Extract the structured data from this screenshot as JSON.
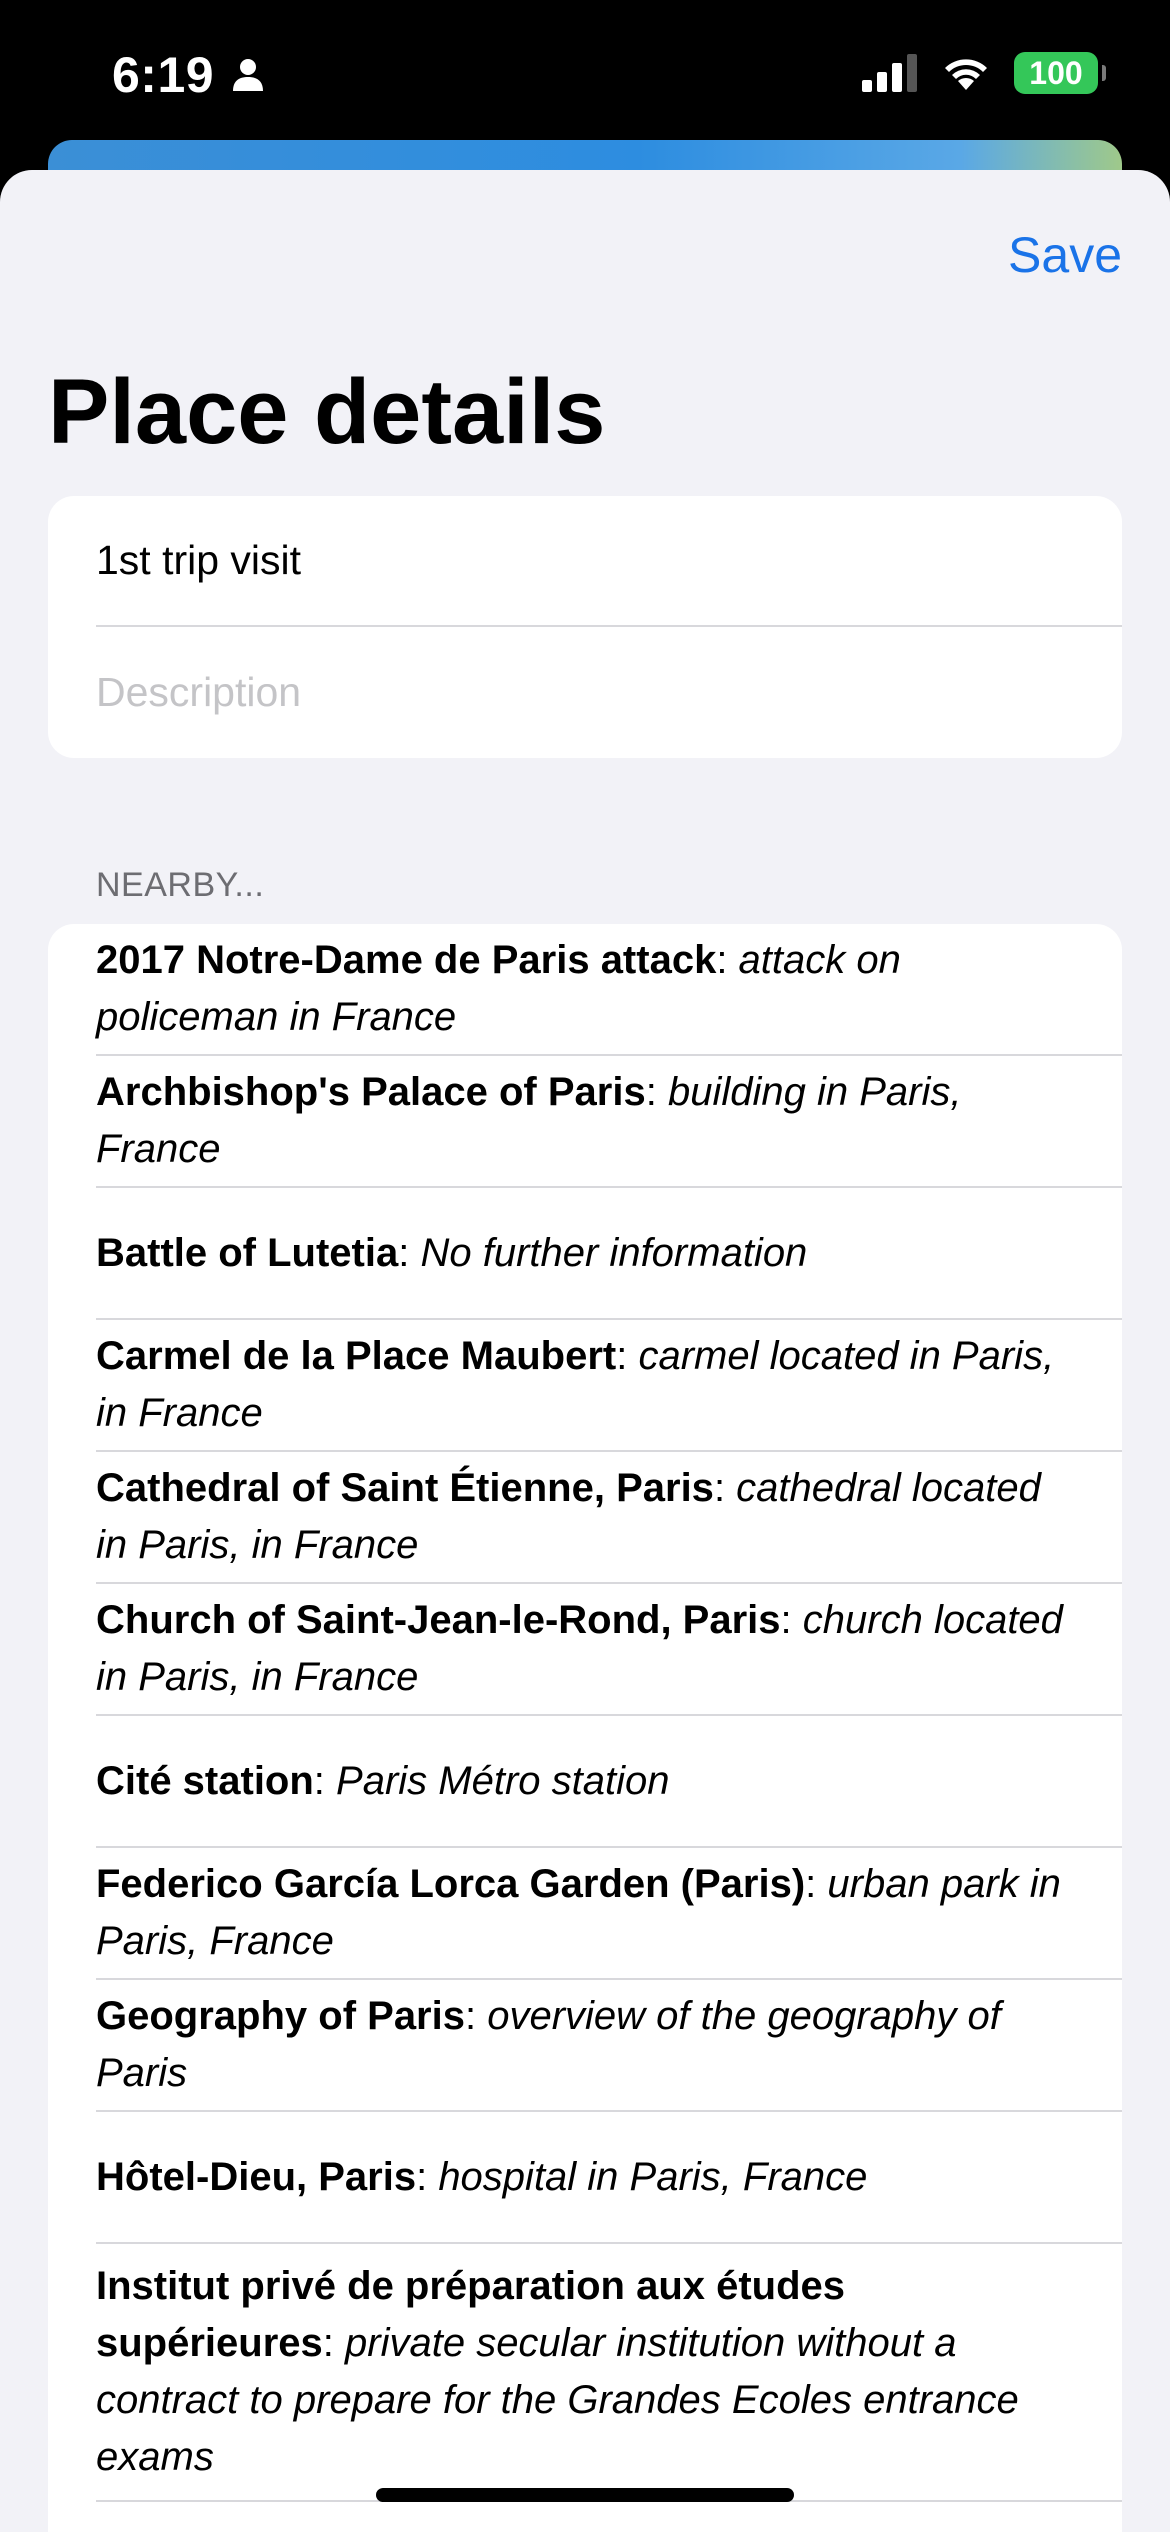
{
  "status_bar": {
    "time": "6:19",
    "battery": "100",
    "icons": [
      "person-icon",
      "signal-icon",
      "wifi-icon",
      "battery-icon"
    ]
  },
  "header": {
    "save_label": "Save",
    "title": "Place details"
  },
  "form": {
    "name_value": "1st trip visit",
    "description_placeholder": "Description"
  },
  "nearby": {
    "section_label": "NEARBY...",
    "items": [
      {
        "title": "2017 Notre-Dame de Paris attack",
        "description": "attack on policeman in France"
      },
      {
        "title": "Archbishop's Palace of Paris",
        "description": "building in Paris, France"
      },
      {
        "title": "Battle of Lutetia",
        "description": "No further information"
      },
      {
        "title": "Carmel de la Place Maubert",
        "description": "carmel located in Paris, in France"
      },
      {
        "title": "Cathedral of Saint Étienne, Paris",
        "description": "cathedral located in Paris, in France"
      },
      {
        "title": "Church of Saint-Jean-le-Rond, Paris",
        "description": "church located in Paris, in France"
      },
      {
        "title": "Cité station",
        "description": "Paris Métro station"
      },
      {
        "title": "Federico García Lorca Garden (Paris)",
        "description": "urban park in Paris, France"
      },
      {
        "title": "Geography of Paris",
        "description": "overview of the geography of Paris"
      },
      {
        "title": "Hôtel-Dieu, Paris",
        "description": "hospital in Paris, France"
      },
      {
        "title": "Institut privé de préparation aux études supérieures",
        "description": "private secular institution without a contract to prepare for the Grandes Ecoles entrance exams"
      }
    ]
  }
}
